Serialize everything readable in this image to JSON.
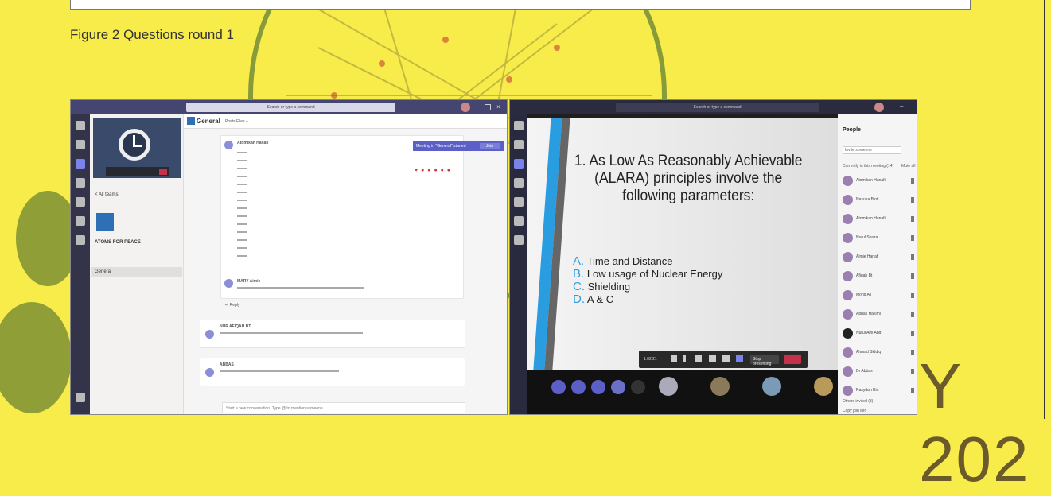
{
  "caption": "Figure 2 Questions round 1",
  "background": {
    "accent": "#f7ec4a",
    "text_left": "Y 202"
  },
  "left_window": {
    "search_placeholder": "Search or type a command",
    "channel_title": "General",
    "channel_tabs": [
      "Posts",
      "Files",
      "+"
    ],
    "team_name": "ATOMS FOR PEACE",
    "channel_item": "General",
    "all_teams": "< All teams",
    "meeting_banner": "Meeting in \"General\" started",
    "meeting_join": "Join",
    "reactions": "♥ ● ● ● ● ●",
    "reply_label": "↩ Reply",
    "compose_placeholder": "Start a new conversation. Type @ to mention someone.",
    "messages": [
      {
        "author": "Atomikan Hanafi",
        "time": "3:30 PM"
      },
      {
        "author": "MARY Aimie",
        "time": "3:34 PM"
      },
      {
        "author": "NUR AFIQAH BT",
        "time": "3:35 PM"
      },
      {
        "author": "ABBAS",
        "time": "3:35 PM"
      }
    ]
  },
  "right_window": {
    "search_placeholder": "Search or type a command",
    "question": "1. As Low As Reasonably Achievable (ALARA) principles involve the following parameters:",
    "options": [
      {
        "letter": "A.",
        "text": "Time and Distance"
      },
      {
        "letter": "B.",
        "text": "Low usage of Nuclear Energy"
      },
      {
        "letter": "C.",
        "text": "Shielding"
      },
      {
        "letter": "D.",
        "text": "A & C"
      }
    ],
    "timer": "1:02:21",
    "stop_presenting": "Stop presenting",
    "people_title": "People",
    "people_search": "Invite someone",
    "in_meeting": "Currently in this meeting (14)",
    "mute_all": "Mute all",
    "participants": [
      "Atomikan Hanafi",
      "Nasuha Binti",
      "Atomikan Hanafi",
      "Nurul Syaza",
      "Aimie Hanafi",
      "Afiqah Bt",
      "Mohd Ali",
      "Abbas Hakimi",
      "Nurul Aini Abd",
      "Ahmad Siddiq",
      "Dr Abbas",
      "Rasydan Bin"
    ],
    "others_invited": "Others invited (3)",
    "copy_join": "Copy join info"
  }
}
